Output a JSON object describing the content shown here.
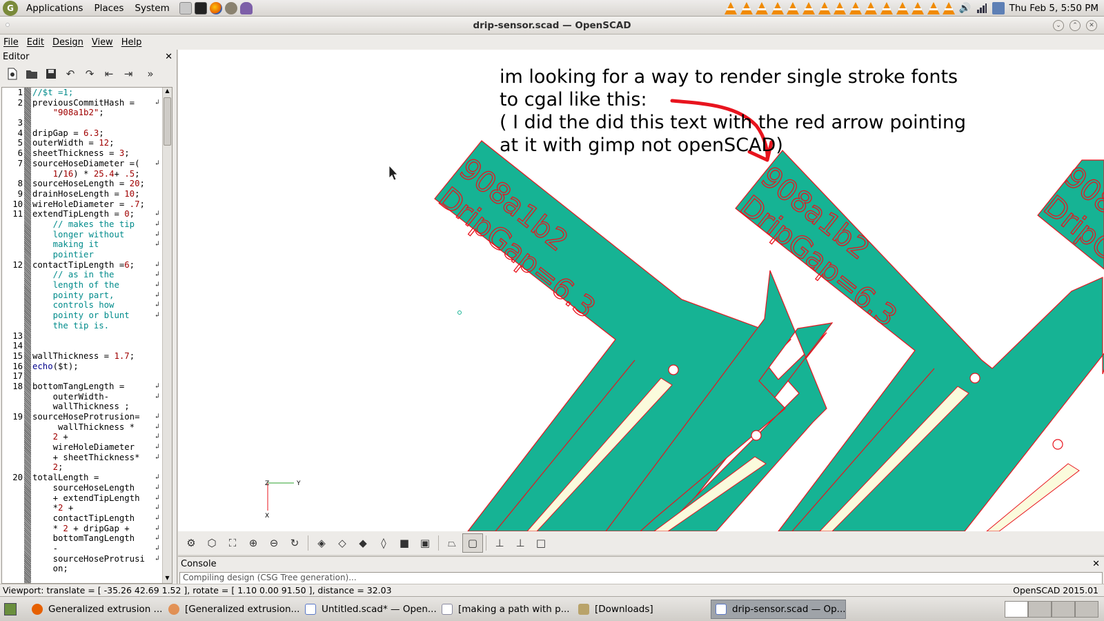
{
  "top_panel": {
    "menus": [
      "Applications",
      "Places",
      "System"
    ],
    "clock": "Thu Feb  5,  5:50 PM"
  },
  "window": {
    "title": "drip-sensor.scad — OpenSCAD"
  },
  "menubar": [
    "File",
    "Edit",
    "Design",
    "View",
    "Help"
  ],
  "editor": {
    "title": "Editor",
    "lines": [
      {
        "n": "1",
        "html": "<span class='cm'>//$t =1;</span>"
      },
      {
        "n": "2",
        "html": "previousCommitHash =",
        "wrap": true
      },
      {
        "n": "",
        "html": "    <span class='str'>\"908a1b2\"</span>;"
      },
      {
        "n": "3",
        "html": ""
      },
      {
        "n": "4",
        "html": "dripGap = <span class='num'>6.3</span>;"
      },
      {
        "n": "5",
        "html": "outerWidth = <span class='num'>12</span>;"
      },
      {
        "n": "6",
        "html": "sheetThickness = <span class='num'>3</span>;"
      },
      {
        "n": "7",
        "html": "sourceHoseDiameter =(",
        "wrap": true
      },
      {
        "n": "",
        "html": "    <span class='num'>1</span>/<span class='num'>16</span>) * <span class='num'>25.4</span>+ <span class='num'>.5</span>;"
      },
      {
        "n": "8",
        "html": "sourceHoseLength = <span class='num'>20</span>;"
      },
      {
        "n": "9",
        "html": "drainHoseLength = <span class='num'>10</span>;"
      },
      {
        "n": "10",
        "html": "wireHoleDiameter = <span class='num'>.7</span>;"
      },
      {
        "n": "11",
        "html": "extendTipLength = <span class='num'>0</span>;",
        "wrap": true
      },
      {
        "n": "",
        "html": "    <span class='cm'>// makes the tip</span>",
        "wrap": true
      },
      {
        "n": "",
        "html": "    <span class='cm'>longer without</span>",
        "wrap": true
      },
      {
        "n": "",
        "html": "    <span class='cm'>making it</span>",
        "wrap": true
      },
      {
        "n": "",
        "html": "    <span class='cm'>pointier</span>"
      },
      {
        "n": "12",
        "html": "contactTipLength =<span class='num'>6</span>;",
        "wrap": true
      },
      {
        "n": "",
        "html": "    <span class='cm'>// as in the</span>",
        "wrap": true
      },
      {
        "n": "",
        "html": "    <span class='cm'>length of the</span>",
        "wrap": true
      },
      {
        "n": "",
        "html": "    <span class='cm'>pointy part,</span>",
        "wrap": true
      },
      {
        "n": "",
        "html": "    <span class='cm'>controls how</span>",
        "wrap": true
      },
      {
        "n": "",
        "html": "    <span class='cm'>pointy or blunt</span>",
        "wrap": true
      },
      {
        "n": "",
        "html": "    <span class='cm'>the tip is.</span>"
      },
      {
        "n": "13",
        "html": ""
      },
      {
        "n": "14",
        "html": ""
      },
      {
        "n": "15",
        "html": "wallThickness = <span class='num'>1.7</span>;"
      },
      {
        "n": "16",
        "html": "<span class='kw'>echo</span>($t);"
      },
      {
        "n": "17",
        "html": ""
      },
      {
        "n": "18",
        "html": "bottomTangLength =",
        "wrap": true
      },
      {
        "n": "",
        "html": "    outerWidth-",
        "wrap": true
      },
      {
        "n": "",
        "html": "    wallThickness ;"
      },
      {
        "n": "19",
        "html": "sourceHoseProtrusion=",
        "wrap": true
      },
      {
        "n": "",
        "html": "     wallThickness *",
        "wrap": true
      },
      {
        "n": "",
        "html": "    <span class='num'>2</span> +",
        "wrap": true
      },
      {
        "n": "",
        "html": "    wireHoleDiameter",
        "wrap": true
      },
      {
        "n": "",
        "html": "    + sheetThickness*",
        "wrap": true
      },
      {
        "n": "",
        "html": "    <span class='num'>2</span>;"
      },
      {
        "n": "20",
        "html": "totalLength =",
        "wrap": true
      },
      {
        "n": "",
        "html": "    sourceHoseLength",
        "wrap": true
      },
      {
        "n": "",
        "html": "    + extendTipLength",
        "wrap": true
      },
      {
        "n": "",
        "html": "    *<span class='num'>2</span> +",
        "wrap": true
      },
      {
        "n": "",
        "html": "    contactTipLength",
        "wrap": true
      },
      {
        "n": "",
        "html": "    * <span class='num'>2</span> + dripGap +",
        "wrap": true
      },
      {
        "n": "",
        "html": "    bottomTangLength",
        "wrap": true
      },
      {
        "n": "",
        "html": "    -",
        "wrap": true
      },
      {
        "n": "",
        "html": "    sourceHoseProtrusi",
        "wrap": true
      },
      {
        "n": "",
        "html": "    on;"
      }
    ]
  },
  "viewport": {
    "annotation": [
      "im looking for a way to render single stroke fonts",
      "to cgal like this:",
      "( I did the did this text with the red arrow pointing",
      "at it with gimp not openSCAD)"
    ],
    "part_text_1": "908a1b2",
    "part_text_2": "DripGap=6.3",
    "axis_labels": {
      "z": "Z",
      "y": "Y",
      "x": "X"
    },
    "colors": {
      "part": "#16b394",
      "edge": "#e8141e",
      "slot": "#fbfbdc"
    }
  },
  "console": {
    "title": "Console",
    "text": "Compiling design (CSG Tree generation)..."
  },
  "statusbar": {
    "viewport_info": "Viewport: translate = [ -35.26 42.69 1.52 ], rotate = [ 1.10 0.00 91.50 ], distance = 32.03",
    "version": "OpenSCAD 2015.01"
  },
  "taskbar": [
    {
      "label": "Generalized extrusion ...",
      "icon": "firefox-icon",
      "color": "#e66000"
    },
    {
      "label": "[Generalized extrusion...",
      "icon": "firefox-icon",
      "color": "#e66000"
    },
    {
      "label": "Untitled.scad* — Open...",
      "icon": "openscad-window-icon",
      "color": "#5a78c8"
    },
    {
      "label": "[making a path with p...",
      "icon": "window-icon",
      "color": "#8a8aa0"
    },
    {
      "label": "[Downloads]",
      "icon": "folder-icon",
      "color": "#b9a36a"
    },
    {
      "label": "drip-sensor.scad — Op...",
      "icon": "openscad-window-icon",
      "color": "#5a78c8",
      "active": true
    }
  ]
}
